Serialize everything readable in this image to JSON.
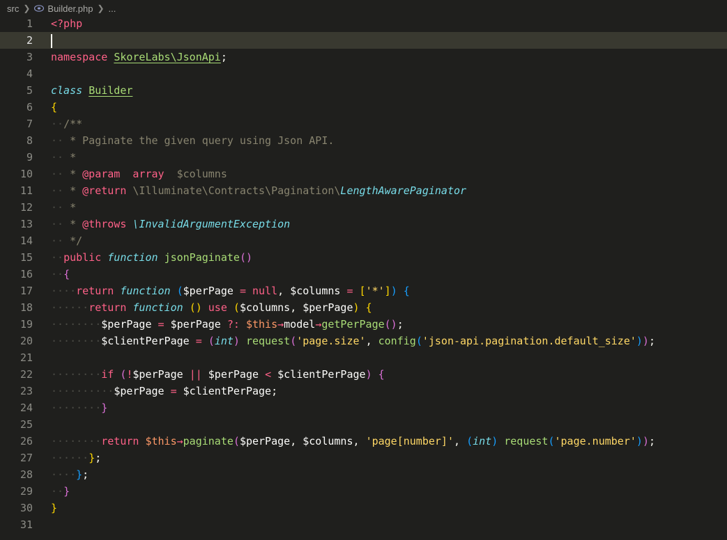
{
  "breadcrumb": {
    "folder": "src",
    "file": "Builder.php",
    "more": "..."
  },
  "editor": {
    "current_line": 2,
    "lines": [
      {
        "n": "1",
        "indent": 0,
        "tokens": [
          [
            "tag",
            "<?php"
          ]
        ]
      },
      {
        "n": "2",
        "indent": 0,
        "tokens": []
      },
      {
        "n": "3",
        "indent": 0,
        "tokens": [
          [
            "kw",
            "namespace"
          ],
          [
            "sp",
            " "
          ],
          [
            "type",
            "SkoreLabs\\JsonApi"
          ],
          [
            "punc",
            ";"
          ]
        ]
      },
      {
        "n": "4",
        "indent": 0,
        "tokens": []
      },
      {
        "n": "5",
        "indent": 0,
        "tokens": [
          [
            "storage",
            "class"
          ],
          [
            "sp",
            " "
          ],
          [
            "type",
            "Builder"
          ]
        ]
      },
      {
        "n": "6",
        "indent": 0,
        "tokens": [
          [
            "br1",
            "{"
          ]
        ]
      },
      {
        "n": "7",
        "indent": 1,
        "tokens": [
          [
            "comment",
            "/**"
          ]
        ]
      },
      {
        "n": "8",
        "indent": 1,
        "tokens": [
          [
            "comment",
            " * Paginate the given query using Json API."
          ]
        ]
      },
      {
        "n": "9",
        "indent": 1,
        "tokens": [
          [
            "comment",
            " *"
          ]
        ]
      },
      {
        "n": "10",
        "indent": 1,
        "tokens": [
          [
            "comment",
            " * "
          ],
          [
            "doctag",
            "@param"
          ],
          [
            "comment",
            "  "
          ],
          [
            "kw",
            "array"
          ],
          [
            "comment",
            "  $columns"
          ]
        ]
      },
      {
        "n": "11",
        "indent": 1,
        "tokens": [
          [
            "comment",
            " * "
          ],
          [
            "doctag",
            "@return"
          ],
          [
            "comment",
            " \\Illuminate\\Contracts\\Pagination\\"
          ],
          [
            "clsi",
            "LengthAwarePaginator"
          ]
        ]
      },
      {
        "n": "12",
        "indent": 1,
        "tokens": [
          [
            "comment",
            " *"
          ]
        ]
      },
      {
        "n": "13",
        "indent": 1,
        "tokens": [
          [
            "comment",
            " * "
          ],
          [
            "doctag",
            "@throws"
          ],
          [
            "comment",
            " "
          ],
          [
            "clsi",
            "\\InvalidArgumentException"
          ]
        ]
      },
      {
        "n": "14",
        "indent": 1,
        "tokens": [
          [
            "comment",
            " */"
          ]
        ]
      },
      {
        "n": "15",
        "indent": 1,
        "tokens": [
          [
            "kw",
            "public"
          ],
          [
            "sp",
            " "
          ],
          [
            "storage",
            "function"
          ],
          [
            "sp",
            " "
          ],
          [
            "fn",
            "jsonPaginate"
          ],
          [
            "br2",
            "()"
          ]
        ]
      },
      {
        "n": "16",
        "indent": 1,
        "tokens": [
          [
            "br2",
            "{"
          ]
        ]
      },
      {
        "n": "17",
        "indent": 2,
        "tokens": [
          [
            "kw",
            "return"
          ],
          [
            "sp",
            " "
          ],
          [
            "storage",
            "function"
          ],
          [
            "sp",
            " "
          ],
          [
            "br3",
            "("
          ],
          [
            "var",
            "$perPage"
          ],
          [
            "sp",
            " "
          ],
          [
            "op",
            "="
          ],
          [
            "sp",
            " "
          ],
          [
            "kw",
            "null"
          ],
          [
            "punc",
            ", "
          ],
          [
            "var",
            "$columns"
          ],
          [
            "sp",
            " "
          ],
          [
            "op",
            "="
          ],
          [
            "sp",
            " "
          ],
          [
            "br1",
            "["
          ],
          [
            "str",
            "'*'"
          ],
          [
            "br1",
            "]"
          ],
          [
            "br3",
            ")"
          ],
          [
            "sp",
            " "
          ],
          [
            "br3",
            "{"
          ]
        ]
      },
      {
        "n": "18",
        "indent": 3,
        "tokens": [
          [
            "kw",
            "return"
          ],
          [
            "sp",
            " "
          ],
          [
            "storage",
            "function"
          ],
          [
            "sp",
            " "
          ],
          [
            "br1",
            "()"
          ],
          [
            "sp",
            " "
          ],
          [
            "kw",
            "use"
          ],
          [
            "sp",
            " "
          ],
          [
            "br1",
            "("
          ],
          [
            "var",
            "$columns"
          ],
          [
            "punc",
            ", "
          ],
          [
            "var",
            "$perPage"
          ],
          [
            "br1",
            ")"
          ],
          [
            "sp",
            " "
          ],
          [
            "br1",
            "{"
          ]
        ]
      },
      {
        "n": "19",
        "indent": 4,
        "tokens": [
          [
            "var",
            "$perPage"
          ],
          [
            "sp",
            " "
          ],
          [
            "op",
            "="
          ],
          [
            "sp",
            " "
          ],
          [
            "var",
            "$perPage"
          ],
          [
            "sp",
            " "
          ],
          [
            "op",
            "?:"
          ],
          [
            "sp",
            " "
          ],
          [
            "this",
            "$this"
          ],
          [
            "op",
            "→"
          ],
          [
            "var",
            "model"
          ],
          [
            "op",
            "→"
          ],
          [
            "fn",
            "getPerPage"
          ],
          [
            "br2",
            "()"
          ],
          [
            "punc",
            ";"
          ]
        ]
      },
      {
        "n": "20",
        "indent": 4,
        "tokens": [
          [
            "var",
            "$clientPerPage"
          ],
          [
            "sp",
            " "
          ],
          [
            "op",
            "="
          ],
          [
            "sp",
            " "
          ],
          [
            "br2",
            "("
          ],
          [
            "storage",
            "int"
          ],
          [
            "br2",
            ")"
          ],
          [
            "sp",
            " "
          ],
          [
            "fn",
            "request"
          ],
          [
            "br2",
            "("
          ],
          [
            "str",
            "'page.size'"
          ],
          [
            "punc",
            ", "
          ],
          [
            "fn",
            "config"
          ],
          [
            "br3",
            "("
          ],
          [
            "str",
            "'json-api.pagination.default_size'"
          ],
          [
            "br3",
            ")"
          ],
          [
            "br2",
            ")"
          ],
          [
            "punc",
            ";"
          ]
        ]
      },
      {
        "n": "21",
        "indent": 0,
        "tokens": []
      },
      {
        "n": "22",
        "indent": 4,
        "tokens": [
          [
            "kw",
            "if"
          ],
          [
            "sp",
            " "
          ],
          [
            "br2",
            "("
          ],
          [
            "op",
            "!"
          ],
          [
            "var",
            "$perPage"
          ],
          [
            "sp",
            " "
          ],
          [
            "op",
            "||"
          ],
          [
            "sp",
            " "
          ],
          [
            "var",
            "$perPage"
          ],
          [
            "sp",
            " "
          ],
          [
            "op",
            "<"
          ],
          [
            "sp",
            " "
          ],
          [
            "var",
            "$clientPerPage"
          ],
          [
            "br2",
            ")"
          ],
          [
            "sp",
            " "
          ],
          [
            "br2",
            "{"
          ]
        ]
      },
      {
        "n": "23",
        "indent": 5,
        "tokens": [
          [
            "var",
            "$perPage"
          ],
          [
            "sp",
            " "
          ],
          [
            "op",
            "="
          ],
          [
            "sp",
            " "
          ],
          [
            "var",
            "$clientPerPage"
          ],
          [
            "punc",
            ";"
          ]
        ]
      },
      {
        "n": "24",
        "indent": 4,
        "tokens": [
          [
            "br2",
            "}"
          ]
        ]
      },
      {
        "n": "25",
        "indent": 0,
        "tokens": []
      },
      {
        "n": "26",
        "indent": 4,
        "tokens": [
          [
            "kw",
            "return"
          ],
          [
            "sp",
            " "
          ],
          [
            "this",
            "$this"
          ],
          [
            "op",
            "→"
          ],
          [
            "fn",
            "paginate"
          ],
          [
            "br2",
            "("
          ],
          [
            "var",
            "$perPage"
          ],
          [
            "punc",
            ", "
          ],
          [
            "var",
            "$columns"
          ],
          [
            "punc",
            ", "
          ],
          [
            "str",
            "'page[number]'"
          ],
          [
            "punc",
            ", "
          ],
          [
            "br3",
            "("
          ],
          [
            "storage",
            "int"
          ],
          [
            "br3",
            ")"
          ],
          [
            "sp",
            " "
          ],
          [
            "fn",
            "request"
          ],
          [
            "br3",
            "("
          ],
          [
            "str",
            "'page.number'"
          ],
          [
            "br3",
            ")"
          ],
          [
            "br2",
            ")"
          ],
          [
            "punc",
            ";"
          ]
        ]
      },
      {
        "n": "27",
        "indent": 3,
        "tokens": [
          [
            "br1",
            "}"
          ],
          [
            "punc",
            ";"
          ]
        ]
      },
      {
        "n": "28",
        "indent": 2,
        "tokens": [
          [
            "br3",
            "}"
          ],
          [
            "punc",
            ";"
          ]
        ]
      },
      {
        "n": "29",
        "indent": 1,
        "tokens": [
          [
            "br2",
            "}"
          ]
        ]
      },
      {
        "n": "30",
        "indent": 0,
        "tokens": [
          [
            "br1",
            "}"
          ]
        ]
      },
      {
        "n": "31",
        "indent": 0,
        "tokens": []
      }
    ]
  },
  "colors": {
    "background": "#1f1f1d",
    "current_line": "#393930",
    "keyword": "#ff6188",
    "storage": "#78dce8",
    "function": "#a9dc76",
    "string": "#ffd866",
    "this": "#fc9867",
    "comment": "#88846f"
  },
  "icons": {
    "file": "php-file-icon",
    "separator": "chevron-right-icon"
  }
}
